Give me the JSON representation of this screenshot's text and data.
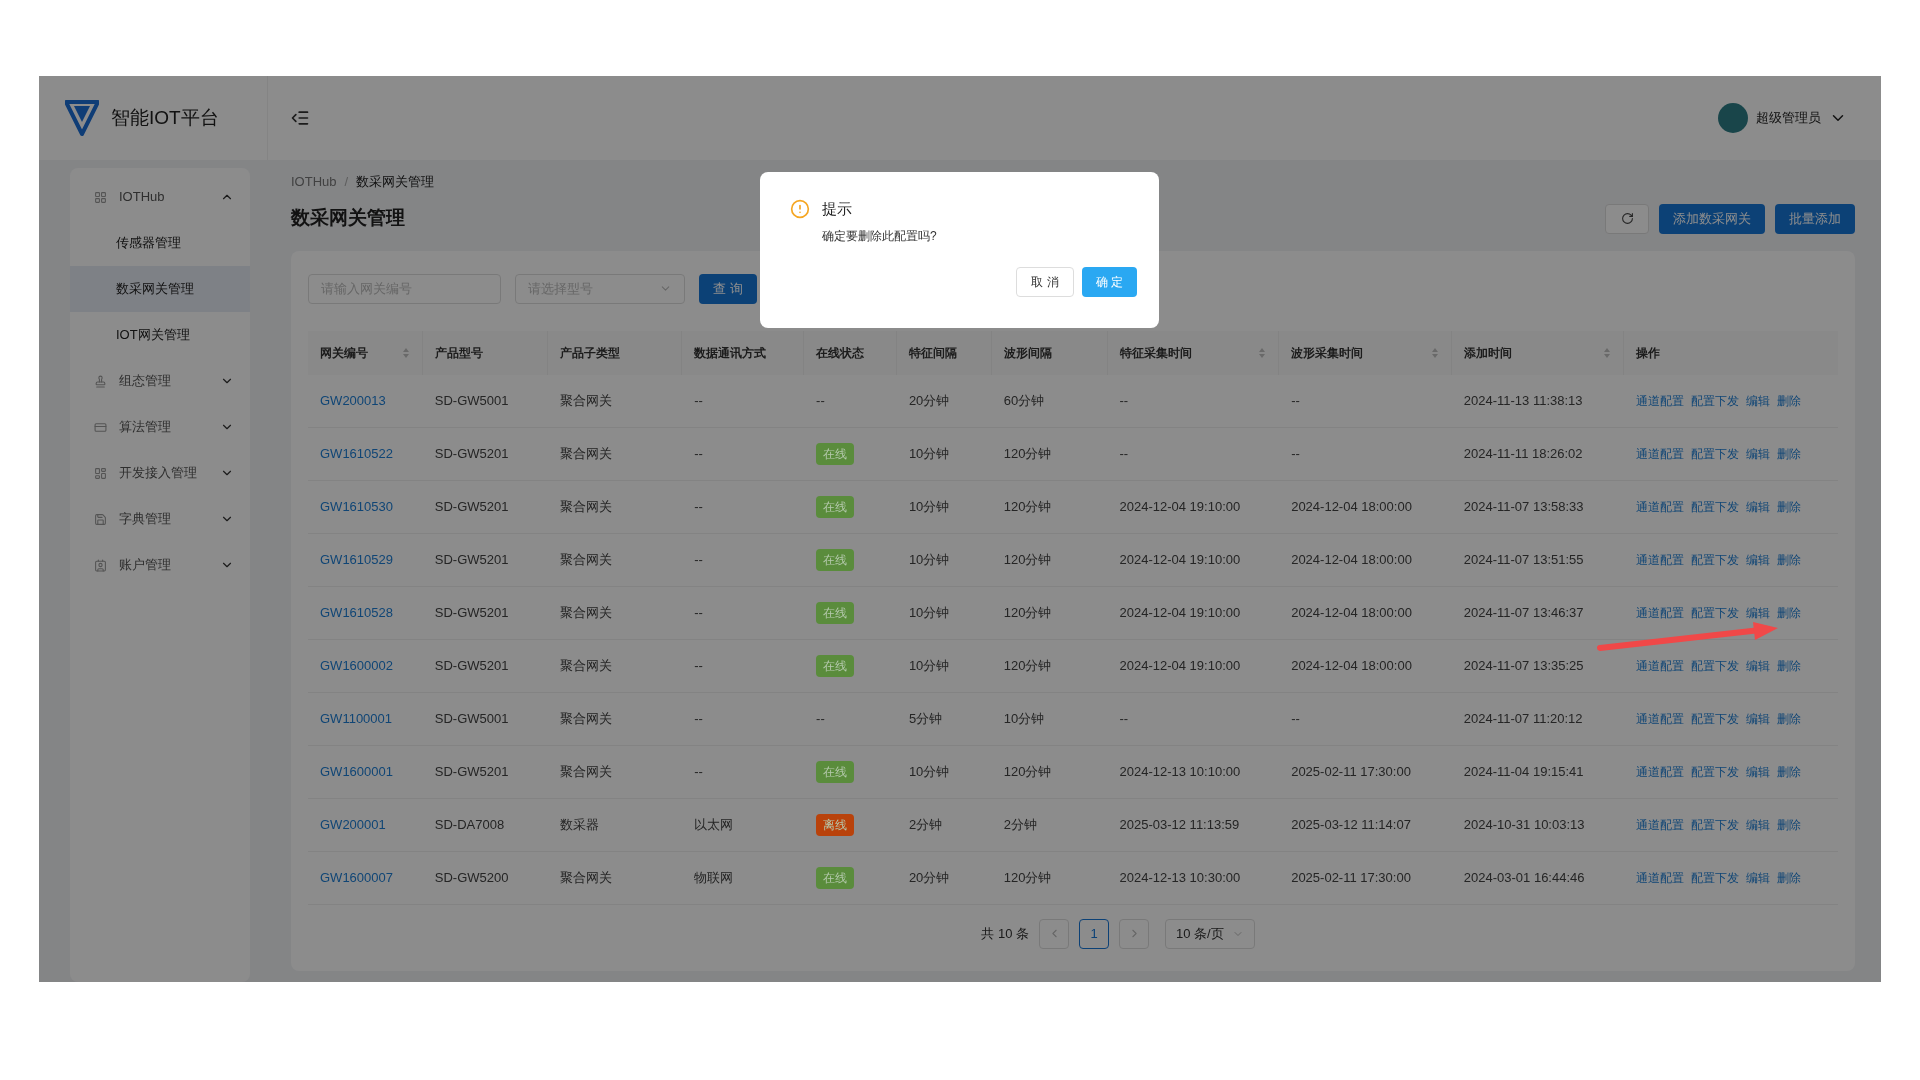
{
  "header": {
    "logo_text": "智能IOT平台",
    "user_name": "超级管理员"
  },
  "sidebar": [
    {
      "label": "IOTHub",
      "expanded": true,
      "children": [
        {
          "label": "传感器管理",
          "selected": false
        },
        {
          "label": "数采网关管理",
          "selected": true
        },
        {
          "label": "IOT网关管理",
          "selected": false
        }
      ]
    },
    {
      "label": "组态管理",
      "expanded": false
    },
    {
      "label": "算法管理",
      "expanded": false
    },
    {
      "label": "开发接入管理",
      "expanded": false
    },
    {
      "label": "字典管理",
      "expanded": false
    },
    {
      "label": "账户管理",
      "expanded": false
    }
  ],
  "breadcrumb": [
    "IOTHub",
    "数采网关管理"
  ],
  "breadcrumb_separator": "/",
  "page_title": "数采网关管理",
  "toolbar_buttons": [
    "添加数采网关",
    "批量添加"
  ],
  "filters": {
    "gateway_placeholder": "请输入网关编号",
    "model_placeholder": "请选择型号",
    "query_button": "查 询"
  },
  "table": {
    "columns": [
      {
        "label": "网关编号",
        "sortable": true
      },
      {
        "label": "产品型号",
        "sortable": false
      },
      {
        "label": "产品子类型",
        "sortable": false
      },
      {
        "label": "数据通讯方式",
        "sortable": false
      },
      {
        "label": "在线状态",
        "sortable": false
      },
      {
        "label": "特征间隔",
        "sortable": false
      },
      {
        "label": "波形间隔",
        "sortable": false
      },
      {
        "label": "特征采集时间",
        "sortable": true
      },
      {
        "label": "波形采集时间",
        "sortable": true
      },
      {
        "label": "添加时间",
        "sortable": true
      },
      {
        "label": "操作",
        "sortable": false
      }
    ],
    "rows": [
      {
        "id": "GW200013",
        "model": "SD-GW5001",
        "subtype": "聚合网关",
        "comm": "--",
        "status": "--",
        "feature_interval": "20分钟",
        "wave_interval": "60分钟",
        "feature_time": "--",
        "wave_time": "--",
        "added": "2024-11-13 11:38:13",
        "actions": [
          "通道配置",
          "配置下发",
          "编辑",
          "删除"
        ]
      },
      {
        "id": "GW1610522",
        "model": "SD-GW5201",
        "subtype": "聚合网关",
        "comm": "--",
        "status": {
          "text": "在线",
          "color": "#5a8c3c"
        },
        "feature_interval": "10分钟",
        "wave_interval": "120分钟",
        "feature_time": "--",
        "wave_time": "--",
        "added": "2024-11-11 18:26:02",
        "actions": [
          "通道配置",
          "配置下发",
          "编辑",
          "删除"
        ]
      },
      {
        "id": "GW1610530",
        "model": "SD-GW5201",
        "subtype": "聚合网关",
        "comm": "--",
        "status": {
          "text": "在线",
          "color": "#5a8c3c"
        },
        "feature_interval": "10分钟",
        "wave_interval": "120分钟",
        "feature_time": "2024-12-04 19:10:00",
        "wave_time": "2024-12-04 18:00:00",
        "added": "2024-11-07 13:58:33",
        "actions": [
          "通道配置",
          "配置下发",
          "编辑",
          "删除"
        ]
      },
      {
        "id": "GW1610529",
        "model": "SD-GW5201",
        "subtype": "聚合网关",
        "comm": "--",
        "status": {
          "text": "在线",
          "color": "#5a8c3c"
        },
        "feature_interval": "10分钟",
        "wave_interval": "120分钟",
        "feature_time": "2024-12-04 19:10:00",
        "wave_time": "2024-12-04 18:00:00",
        "added": "2024-11-07 13:51:55",
        "actions": [
          "通道配置",
          "配置下发",
          "编辑",
          "删除"
        ]
      },
      {
        "id": "GW1610528",
        "model": "SD-GW5201",
        "subtype": "聚合网关",
        "comm": "--",
        "status": {
          "text": "在线",
          "color": "#5a8c3c"
        },
        "feature_interval": "10分钟",
        "wave_interval": "120分钟",
        "feature_time": "2024-12-04 19:10:00",
        "wave_time": "2024-12-04 18:00:00",
        "added": "2024-11-07 13:46:37",
        "actions": [
          "通道配置",
          "配置下发",
          "编辑",
          "删除"
        ]
      },
      {
        "id": "GW1600002",
        "model": "SD-GW5201",
        "subtype": "聚合网关",
        "comm": "--",
        "status": {
          "text": "在线",
          "color": "#5a8c3c"
        },
        "feature_interval": "10分钟",
        "wave_interval": "120分钟",
        "feature_time": "2024-12-04 19:10:00",
        "wave_time": "2024-12-04 18:00:00",
        "added": "2024-11-07 13:35:25",
        "actions": [
          "通道配置",
          "配置下发",
          "编辑",
          "删除"
        ]
      },
      {
        "id": "GW1100001",
        "model": "SD-GW5001",
        "subtype": "聚合网关",
        "comm": "--",
        "status": "--",
        "feature_interval": "5分钟",
        "wave_interval": "10分钟",
        "feature_time": "--",
        "wave_time": "--",
        "added": "2024-11-07 11:20:12",
        "actions": [
          "通道配置",
          "配置下发",
          "编辑",
          "删除"
        ]
      },
      {
        "id": "GW1600001",
        "model": "SD-GW5201",
        "subtype": "聚合网关",
        "comm": "--",
        "status": {
          "text": "在线",
          "color": "#5a8c3c"
        },
        "feature_interval": "10分钟",
        "wave_interval": "120分钟",
        "feature_time": "2024-12-13 10:10:00",
        "wave_time": "2025-02-11 17:30:00",
        "added": "2024-11-04 19:15:41",
        "actions": [
          "通道配置",
          "配置下发",
          "编辑",
          "删除"
        ]
      },
      {
        "id": "GW200001",
        "model": "SD-DA7008",
        "subtype": "数采器",
        "comm": "以太网",
        "status": {
          "text": "离线",
          "color": "#b9420b"
        },
        "feature_interval": "2分钟",
        "wave_interval": "2分钟",
        "feature_time": "2025-03-12 11:13:59",
        "wave_time": "2025-03-12 11:14:07",
        "added": "2024-10-31 10:03:13",
        "actions": [
          "通道配置",
          "配置下发",
          "编辑",
          "删除"
        ]
      },
      {
        "id": "GW1600007",
        "model": "SD-GW5200",
        "subtype": "聚合网关",
        "comm": "物联网",
        "status": {
          "text": "在线",
          "color": "#5a8c3c"
        },
        "feature_interval": "20分钟",
        "wave_interval": "120分钟",
        "feature_time": "2024-12-13 10:30:00",
        "wave_time": "2025-02-11 17:30:00",
        "added": "2024-03-01 16:44:46",
        "actions": [
          "通道配置",
          "配置下发",
          "编辑",
          "删除"
        ]
      }
    ]
  },
  "pagination": {
    "total": "共 10 条",
    "pages": [
      {
        "label": "1",
        "selected": true
      }
    ],
    "page_size": "10 条/页"
  },
  "dialog": {
    "title": "提示",
    "message": "确定要删除此配置吗?",
    "cancel": "取 消",
    "confirm": "确 定"
  }
}
